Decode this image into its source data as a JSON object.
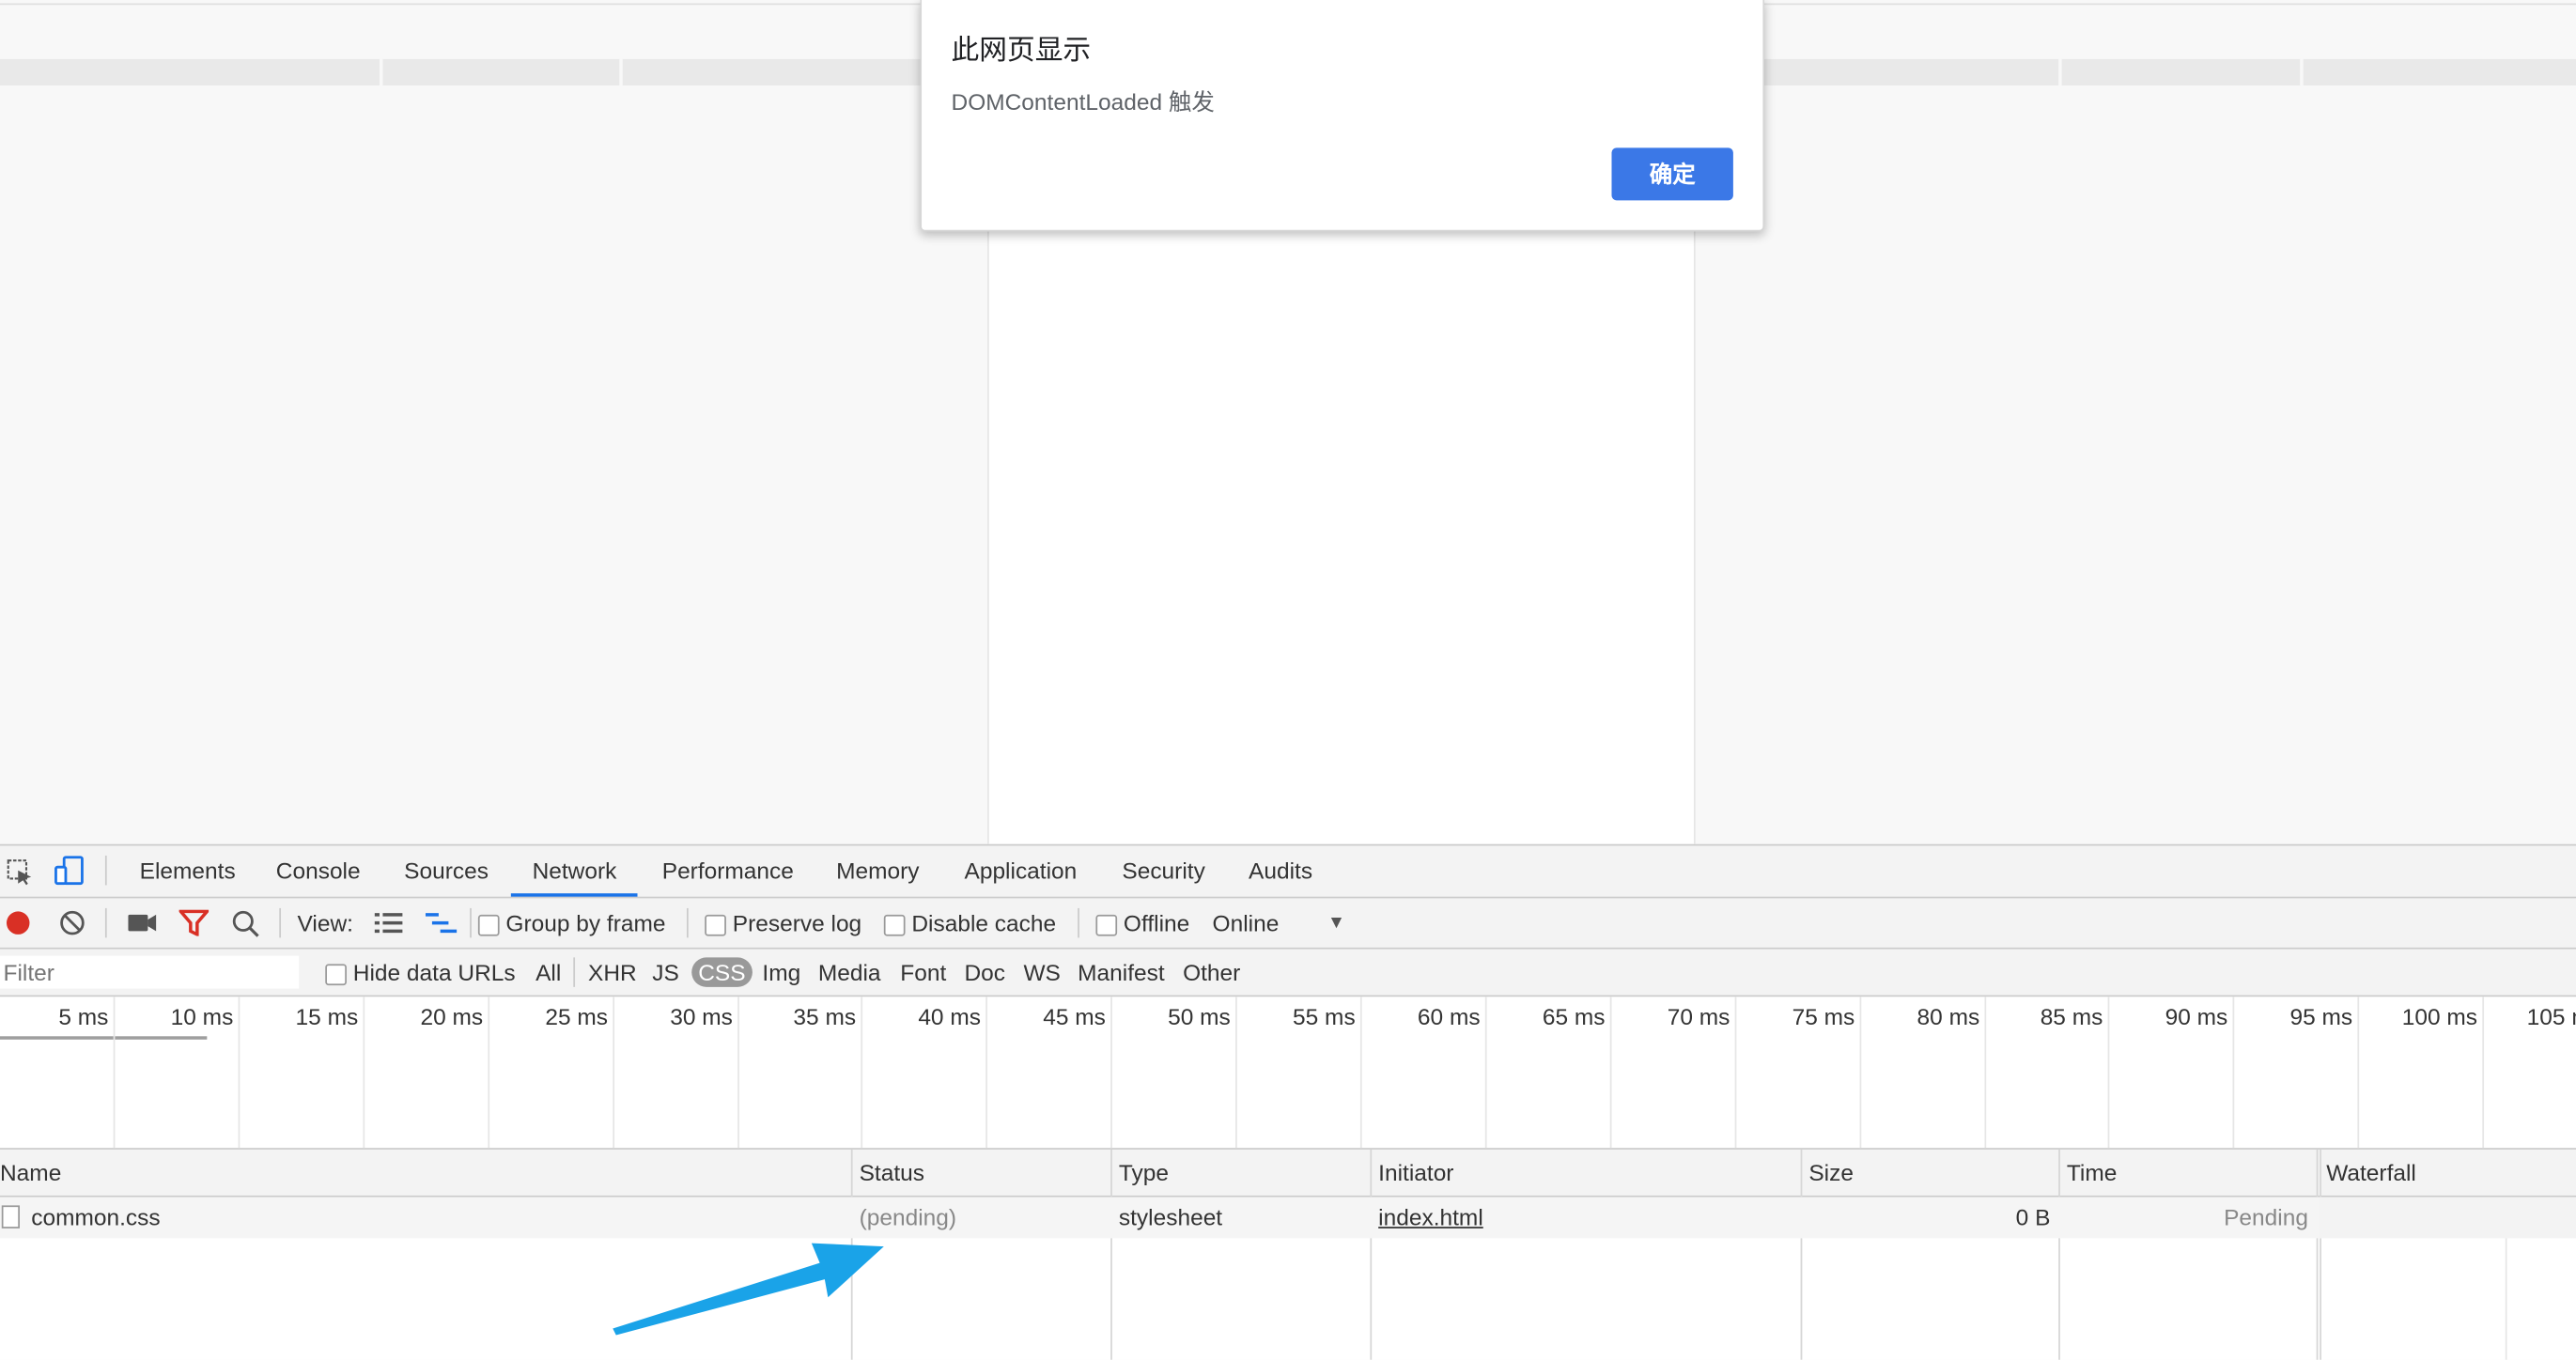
{
  "dialog": {
    "title": "此网页显示",
    "message": "DOMContentLoaded 触发",
    "ok_label": "确定"
  },
  "tabs": [
    "Elements",
    "Console",
    "Sources",
    "Network",
    "Performance",
    "Memory",
    "Application",
    "Security",
    "Audits"
  ],
  "active_tab": "Network",
  "toolbar": {
    "view_label": "View:",
    "group_by_frame": "Group by frame",
    "preserve_log": "Preserve log",
    "disable_cache": "Disable cache",
    "offline": "Offline",
    "throttle": "Online",
    "record_color": "#d93025",
    "filter_icon_color": "#d93025"
  },
  "filterbar": {
    "filter_placeholder": "Filter",
    "hide_data_urls": "Hide data URLs",
    "types": [
      "All",
      "XHR",
      "JS",
      "CSS",
      "Img",
      "Media",
      "Font",
      "Doc",
      "WS",
      "Manifest",
      "Other"
    ],
    "active_type": "CSS"
  },
  "overview_ticks": [
    "5 ms",
    "10 ms",
    "15 ms",
    "20 ms",
    "25 ms",
    "30 ms",
    "35 ms",
    "40 ms",
    "45 ms",
    "50 ms",
    "55 ms",
    "60 ms",
    "65 ms",
    "70 ms",
    "75 ms",
    "80 ms",
    "85 ms",
    "90 ms",
    "95 ms",
    "100 ms",
    "105 ms"
  ],
  "table": {
    "columns": [
      "Name",
      "Status",
      "Type",
      "Initiator",
      "Size",
      "Time",
      "Waterfall"
    ],
    "rows": [
      {
        "name": "common.css",
        "status": "(pending)",
        "type": "stylesheet",
        "initiator": "index.html",
        "size": "0 B",
        "time": "Pending"
      }
    ]
  },
  "annotation": {
    "arrow_color": "#1aa3e8"
  }
}
